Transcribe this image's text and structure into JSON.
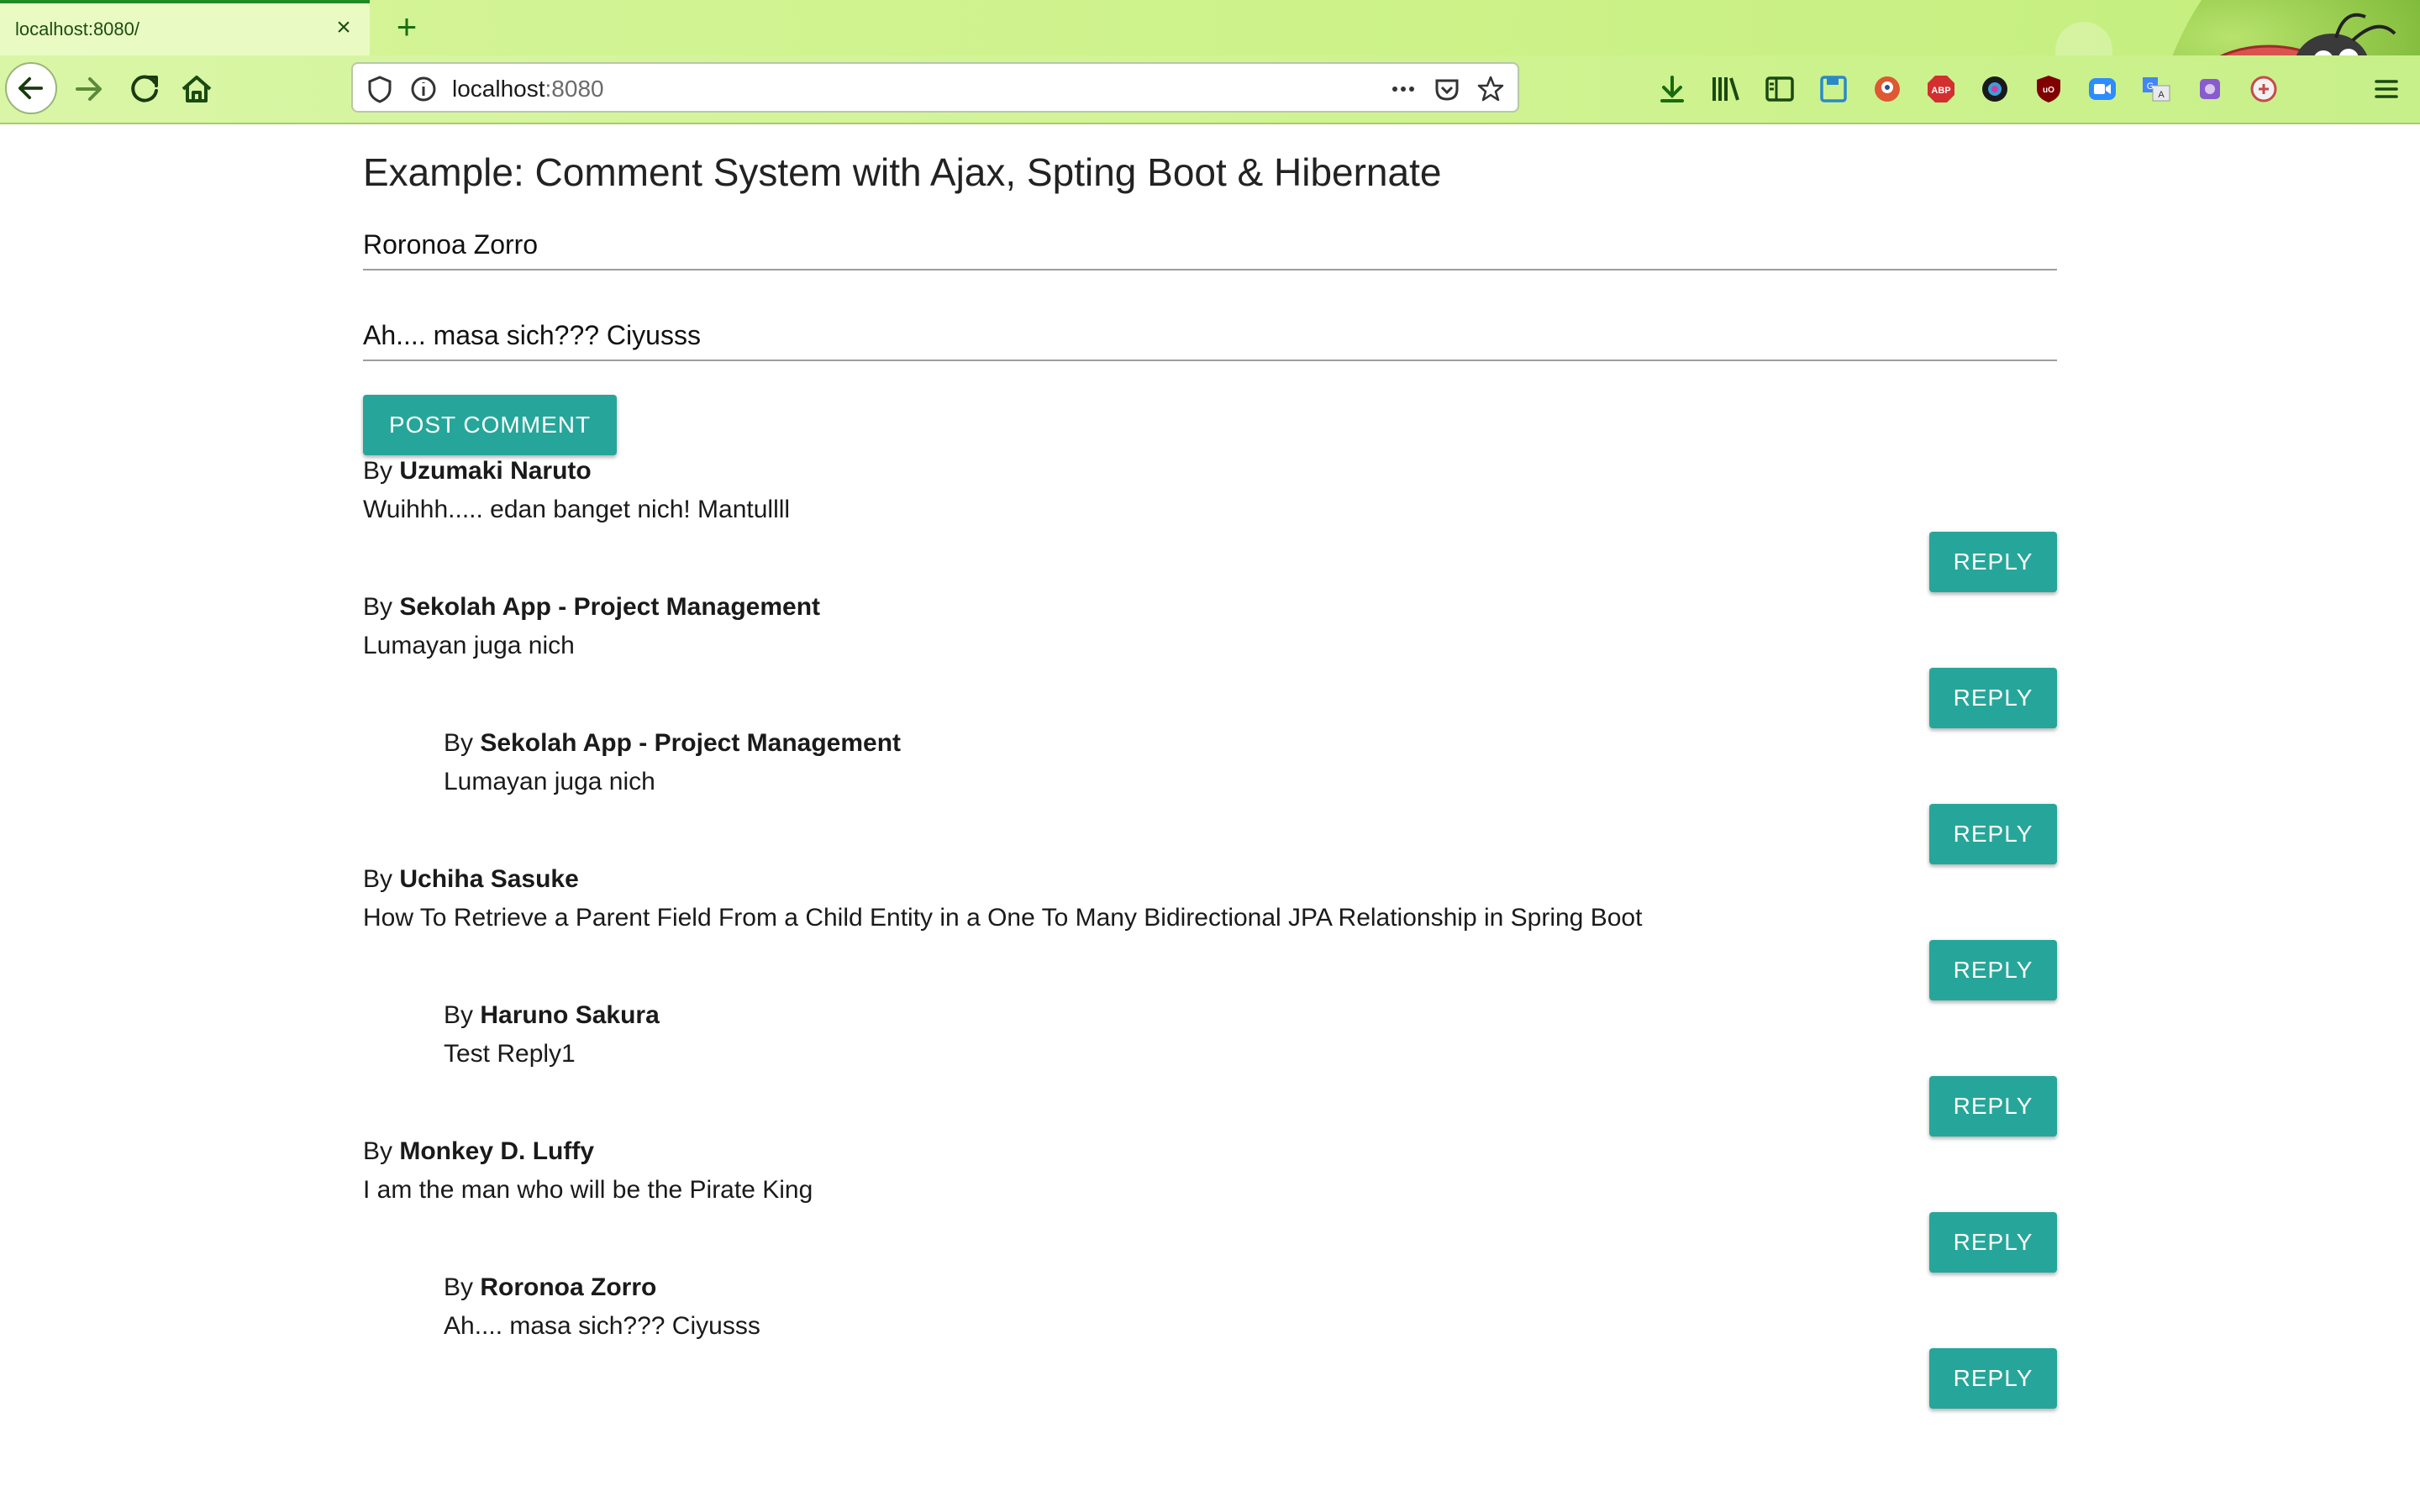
{
  "browser": {
    "tab_title": "localhost:8080/",
    "tab_close_icon": "close-icon",
    "new_tab_icon": "plus-icon",
    "url_host": "localhost",
    "url_port": ":8080",
    "toolbar_icons": [
      "download-icon",
      "library-icon",
      "sidebar-icon",
      "save-icon",
      "duckduckgo-icon",
      "adblock-icon",
      "camera-icon",
      "ublock-icon",
      "zoom-icon",
      "translate-icon",
      "extension-icon",
      "extension-icon",
      "menu-icon"
    ]
  },
  "page": {
    "title": "Example: Comment System with Ajax, Spting Boot & Hibernate",
    "name_value": "Roronoa Zorro",
    "comment_value": "Ah.... masa sich??? Ciyusss",
    "post_label": "POST COMMENT",
    "by_prefix": "By",
    "reply_label": "REPLY"
  },
  "comments": [
    {
      "author": "Uzumaki Naruto",
      "text": "Wuihhh..... edan banget nich! Mantullll"
    },
    {
      "author": "Sekolah App - Project Management",
      "text": "Lumayan juga nich"
    },
    {
      "author": "Sekolah App - Project Management",
      "text": "Lumayan juga nich"
    },
    {
      "author": "Uchiha Sasuke",
      "text": "How To Retrieve a Parent Field From a Child Entity in a One To Many Bidirectional JPA Relationship in Spring Boot"
    },
    {
      "author": "Haruno Sakura",
      "text": "Test Reply1"
    },
    {
      "author": "Monkey D. Luffy",
      "text": "I am the man who will be the Pirate King"
    },
    {
      "author": "Roronoa Zorro",
      "text": "Ah.... masa sich??? Ciyusss"
    }
  ],
  "colors": {
    "accent": "#26a69a",
    "chrome_green": "#cff390"
  }
}
